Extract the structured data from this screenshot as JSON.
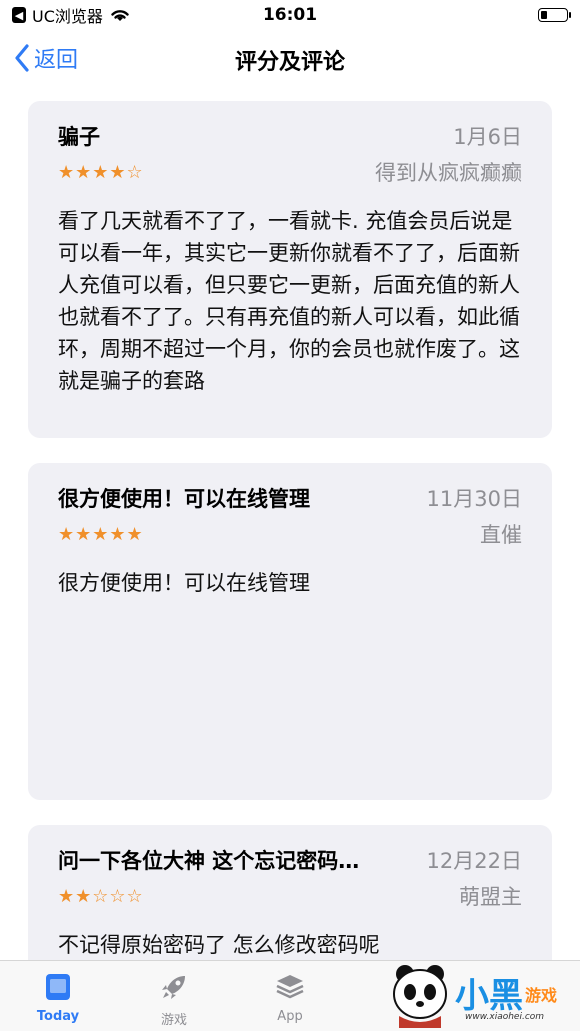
{
  "status_bar": {
    "app_back": "UC浏览器",
    "time": "16:01",
    "battery_level": 0.25
  },
  "nav": {
    "back_label": "返回",
    "title": "评分及评论"
  },
  "reviews": [
    {
      "title": "骗子",
      "date": "1月6日",
      "stars": "★★★★☆",
      "rating": 4,
      "author": "得到从疯疯癫癫",
      "body": "看了几天就看不了了，一看就卡. 充值会员后说是可以看一年，其实它一更新你就看不了了，后面新人充值可以看，但只要它一更新，后面充值的新人也就看不了了。只有再充值的新人可以看，如此循环，周期不超过一个月，你的会员也就作废了。这就是骗子的套路"
    },
    {
      "title": "很方便使用！可以在线管理",
      "date": "11月30日",
      "stars": "★★★★★",
      "rating": 5,
      "author": "直催",
      "body": "很方便使用！可以在线管理"
    },
    {
      "title": "问一下各位大神  这个忘记密码…",
      "date": "12月22日",
      "stars": "★★☆☆☆",
      "rating": 2,
      "author": "萌盟主",
      "body": "不记得原始密码了 怎么修改密码呢"
    }
  ],
  "tabs": [
    {
      "label": "Today",
      "icon": "today-icon",
      "active": true
    },
    {
      "label": "游戏",
      "icon": "rocket-icon",
      "active": false
    },
    {
      "label": "App",
      "icon": "layers-icon",
      "active": false
    }
  ],
  "watermark": {
    "text": "小黑",
    "sub": "游戏",
    "url": "www.xiaohei.com"
  },
  "colors": {
    "accent": "#2f7bf5",
    "star": "#f0902b",
    "secondary_text": "#8e8e93",
    "card_bg": "#f0f0f5"
  }
}
